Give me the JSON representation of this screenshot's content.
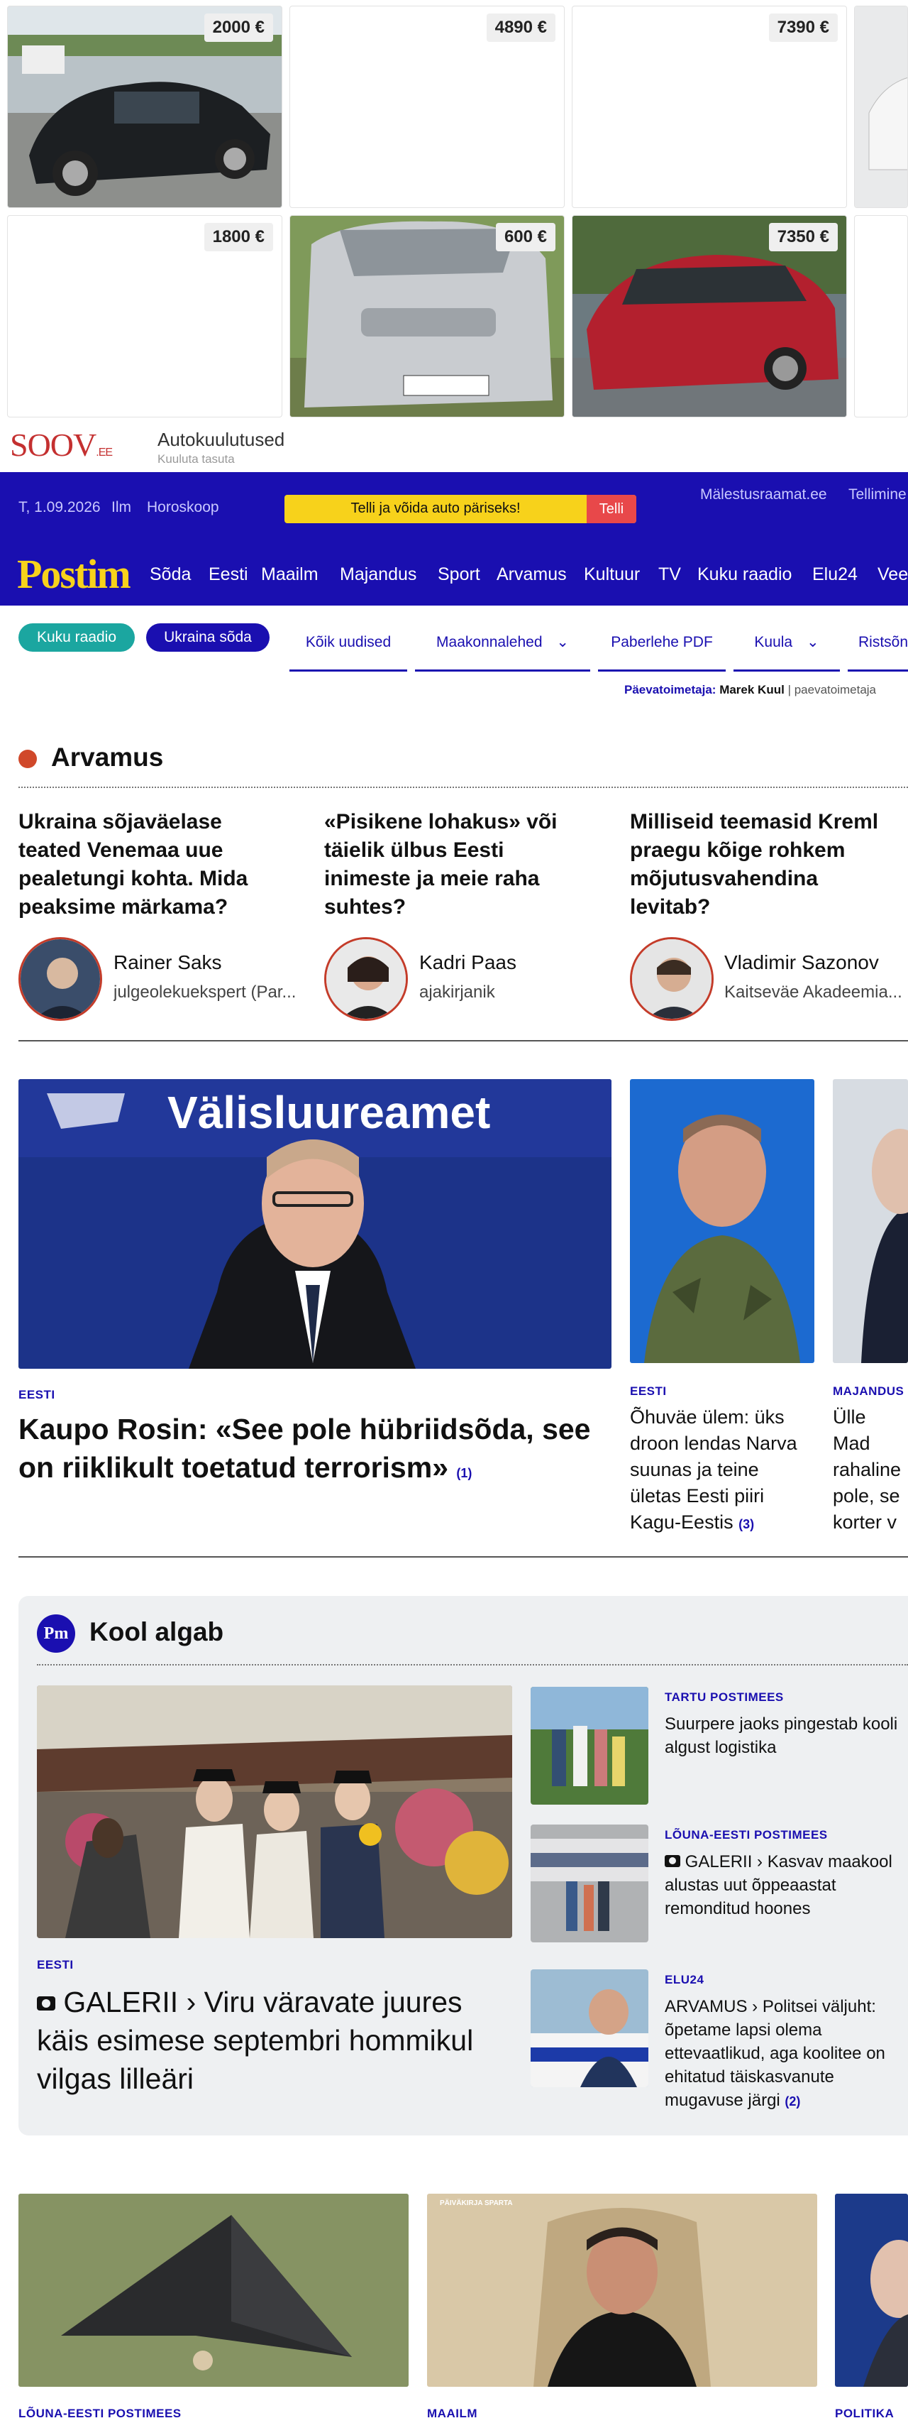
{
  "ad": {
    "prices": [
      "2000 €",
      "4890 €",
      "7390 €",
      "1800 €",
      "600 €",
      "7350 €"
    ],
    "brand": "SOOV",
    "brand_suffix": ".EE",
    "title": "Autokuulutused",
    "subtitle": "Kuuluta tasuta"
  },
  "topbar": {
    "date": "T, 1.09.2026",
    "weather": "Ilm",
    "horoscope": "Horoskoop",
    "promo": "Telli ja võida auto päriseks!",
    "promo_button": "Telli",
    "links": [
      "Mälestusraamat.ee",
      "Tellimine"
    ]
  },
  "nav": {
    "logo": "Postim",
    "items": [
      "Sõda",
      "Eesti",
      "Maailm",
      "Majandus",
      "Sport",
      "Arvamus",
      "Kultuur",
      "TV",
      "Kuku raadio",
      "Elu24",
      "Vee"
    ]
  },
  "subnav": {
    "pills": [
      "Kuku raadio",
      "Ukraina sõda"
    ],
    "tabs": [
      "Kõik uudised",
      "Maakonnalehed",
      "Paberlehe PDF",
      "Kuula",
      "Ristsõn"
    ],
    "editor_label": "Päevatoimetaja:",
    "editor_name": "Marek Kuul",
    "editor_extra": "paevatoimetaja"
  },
  "opinion": {
    "title": "Arvamus",
    "items": [
      {
        "headline": "Ukraina sõjaväelase teated Venemaa uue pealetungi kohta. Mida peaksime märkama?",
        "author": "Rainer Saks",
        "role": "julgeolekuekspert (Par..."
      },
      {
        "headline": "«Pisikene lohakus» või täielik ülbus Eesti inimeste ja meie raha suhtes?",
        "author": "Kadri Paas",
        "role": "ajakirjanik"
      },
      {
        "headline": "Milliseid teemasid Kreml praegu kõige rohkem mõjutusvahendina levitab?",
        "author": "Vladimir Sazonov",
        "role": "Kaitseväe Akadeemia..."
      }
    ]
  },
  "top_news": {
    "main": {
      "category": "EESTI",
      "headline": "Kaupo Rosin: «See pole hübriidsõda, see on riiklikult toetatud terrorism»",
      "count": "(1)",
      "image_text": "Välisluureamet"
    },
    "second": {
      "category": "EESTI",
      "headline": "Õhuväe ülem: üks droon lendas Narva suunas ja teine ületas Eesti piiri Kagu-Eestis",
      "count": "(3)"
    },
    "third": {
      "category": "MAJANDUS",
      "headline": "Ülle Mad rahaline pole, se korter v"
    }
  },
  "school": {
    "badge": "Pm",
    "title": "Kool algab",
    "main": {
      "category": "EESTI",
      "gallery": "GALERII",
      "headline": "Viru väravate juures käis esimese septembri hommikul vilgas lilleäri"
    },
    "side": [
      {
        "category": "TARTU POSTIMEES",
        "headline": "Suurpere jaoks pingestab kooli algust logistika"
      },
      {
        "category": "LÕUNA-EESTI POSTIMEES",
        "gallery": "GALERII",
        "headline": "Kasvav maakool alustas uut õppeaastat remonditud hoones"
      },
      {
        "category": "ELU24",
        "gallery": "ARVAMUS",
        "headline": "Politsei väljuht: õpetame lapsi olema ettevaatlikud, aga koolitee on ehitatud täiskasvanute mugavuse järgi",
        "count": "(2)"
      }
    ]
  },
  "bottom": {
    "cats": [
      "LÕUNA-EESTI POSTIMEES",
      "MAAILM",
      "POLITIKA"
    ],
    "image_caption": "PÄIVÄKIRJA SPARTA"
  }
}
